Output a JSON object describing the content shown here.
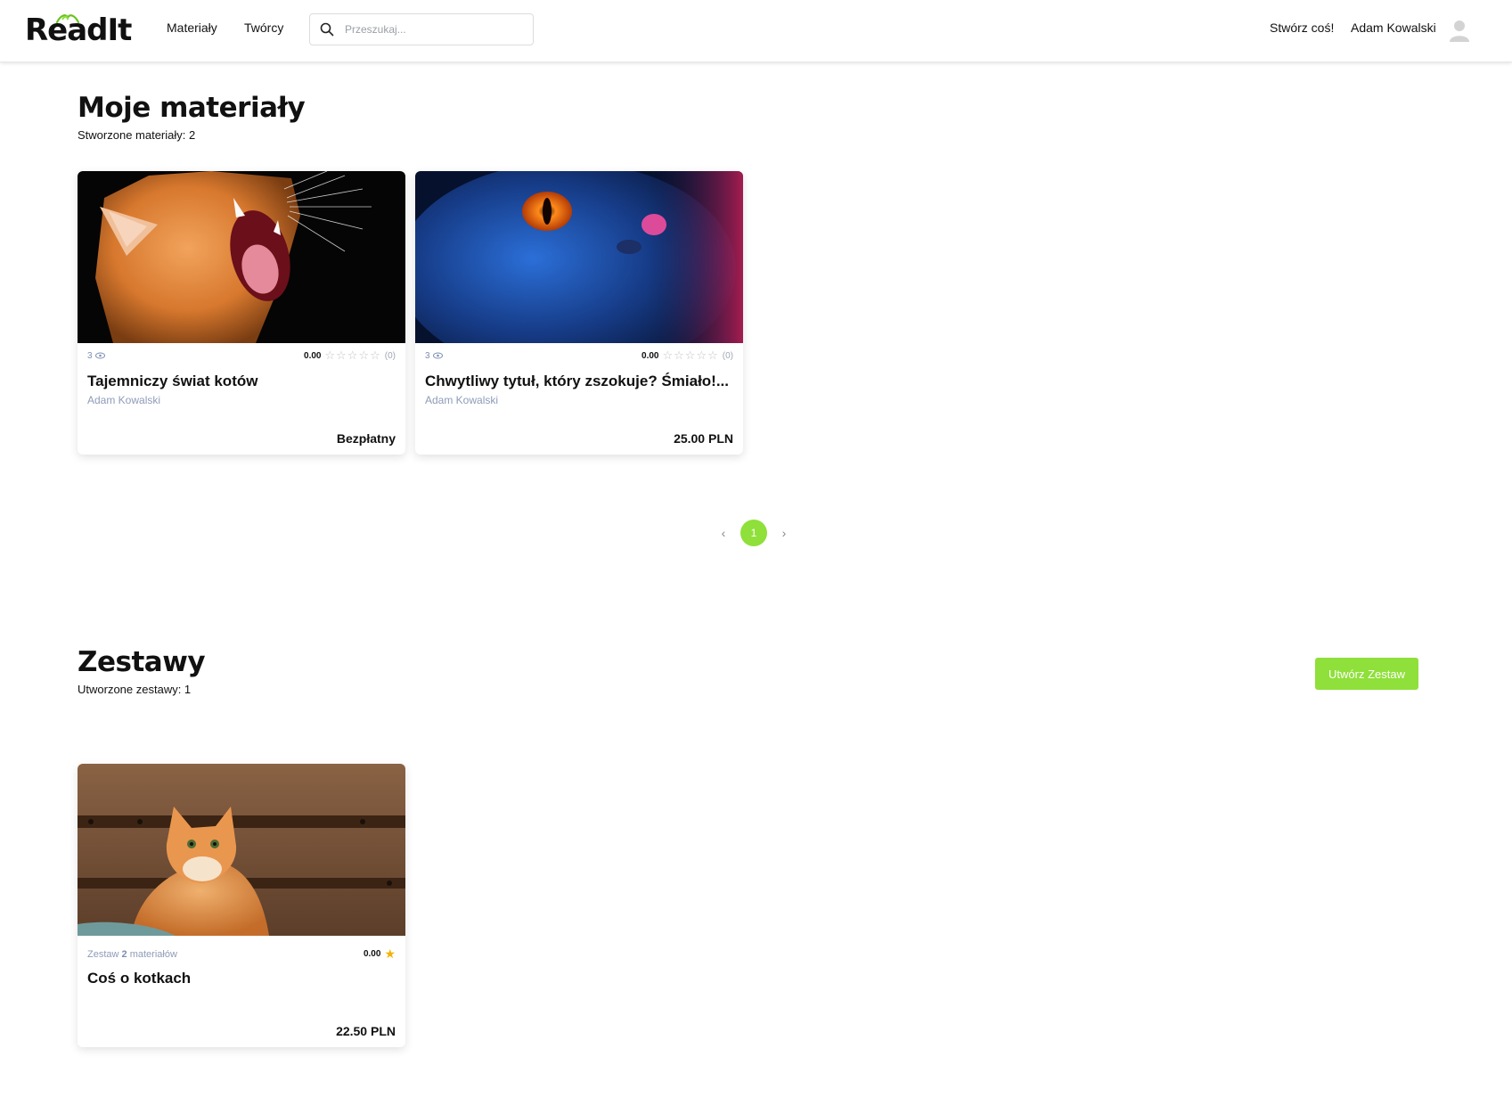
{
  "nav": {
    "logo": "ReadIt",
    "links": [
      "Materiały",
      "Twórcy"
    ],
    "search_placeholder": "Przeszukaj...",
    "create": "Stwórz coś!",
    "user": "Adam Kowalski",
    "accent": "#8fe03a"
  },
  "materials": {
    "title": "Moje materiały",
    "count_label": "Stworzone materiały: 2",
    "cards": [
      {
        "image": "orange cat yawning on black background",
        "views": "3",
        "rating": "0.00",
        "rating_count": "(0)",
        "title": "Tajemniczy świat kotów",
        "author": "Adam Kowalski",
        "price": "Bezpłatny"
      },
      {
        "image": "neon blue cat with glowing orange eyes",
        "views": "3",
        "rating": "0.00",
        "rating_count": "(0)",
        "title": "Chwytliwy tytuł, który zszokuje? Śmiało!...",
        "author": "Adam Kowalski",
        "price": "25.00 PLN"
      }
    ],
    "pagination": {
      "current": "1",
      "prev": "‹",
      "next": "›"
    }
  },
  "sets": {
    "title": "Zestawy",
    "count_label": "Utworzone zestawy: 1",
    "create_button": "Utwórz Zestaw",
    "cards": [
      {
        "image": "orange cat sitting in front of wooden wall",
        "prefix": "Zestaw",
        "count": "2",
        "suffix": "materiałów",
        "rating": "0.00",
        "title": "Coś o kotkach",
        "price": "22.50 PLN"
      }
    ]
  }
}
